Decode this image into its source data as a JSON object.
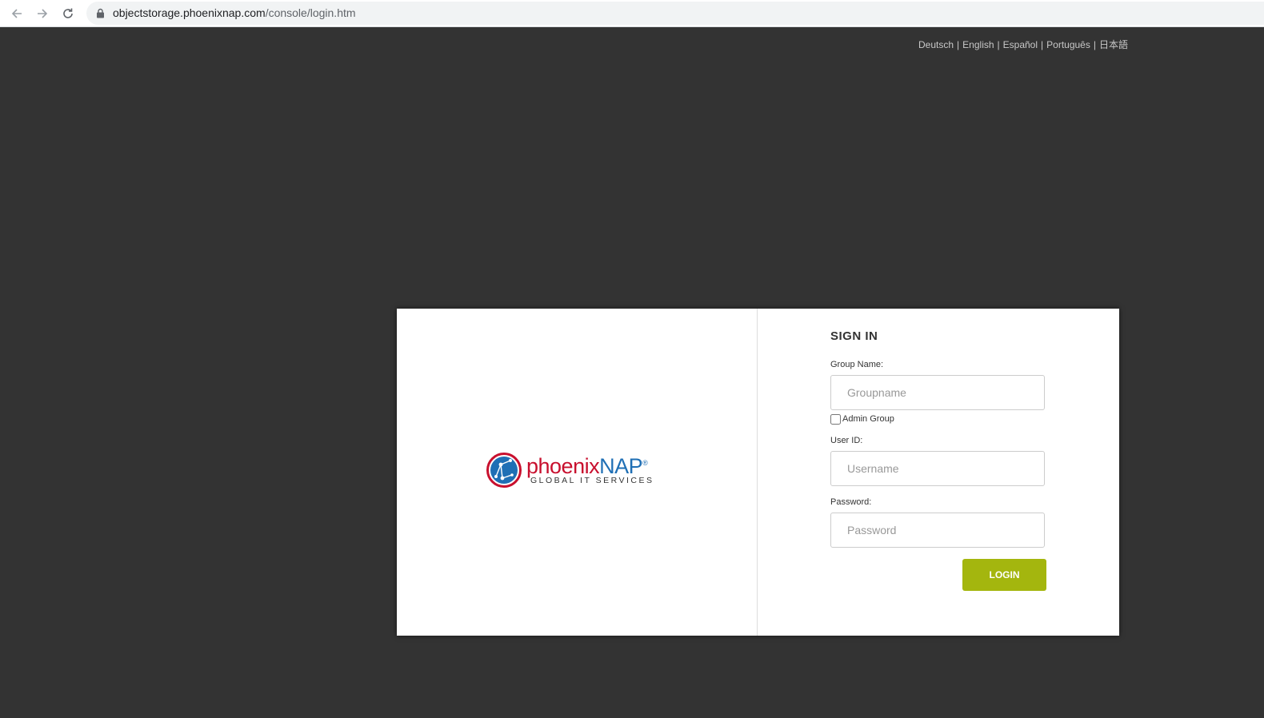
{
  "browser": {
    "url_host": "objectstorage.phoenixnap.com",
    "url_path": "/console/login.htm"
  },
  "languages": [
    "Deutsch",
    "English",
    "Español",
    "Português",
    "日本語"
  ],
  "logo": {
    "name_part1": "phoenix",
    "name_part2": "NAP",
    "registered": "®",
    "tagline": "GLOBAL IT SERVICES"
  },
  "form": {
    "title": "SIGN IN",
    "group_label": "Group Name:",
    "group_placeholder": "Groupname",
    "admin_group_label": "Admin Group",
    "userid_label": "User ID:",
    "userid_placeholder": "Username",
    "password_label": "Password:",
    "password_placeholder": "Password",
    "login_label": "LOGIN"
  },
  "colors": {
    "background": "#333333",
    "login_button": "#a4b60e",
    "logo_red": "#c8102e",
    "logo_blue": "#1f6fb5"
  }
}
